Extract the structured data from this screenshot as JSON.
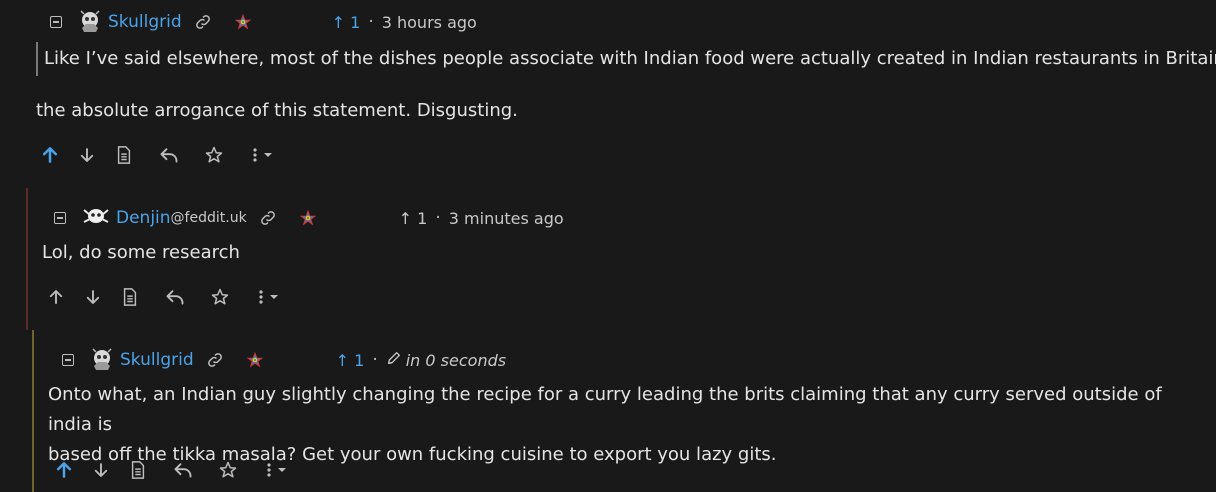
{
  "comments": [
    {
      "author": "Skullgrid",
      "instance": "",
      "score": "1",
      "time": "3 hours ago",
      "quote": "Like I’ve said elsewhere, most of the dishes people associate with Indian food were actually created in Indian restaurants in Britain.",
      "body": "the absolute arrogance of this statement. Disgusting.",
      "upvoted": true
    },
    {
      "author": "Denjin",
      "instance": "@feddit.uk",
      "score": "1",
      "time": "3 minutes ago",
      "body": "Lol, do some research",
      "upvoted": false
    },
    {
      "author": "Skullgrid",
      "instance": "",
      "score": "1",
      "time": "in 0 seconds",
      "body_line1": "Onto what, an Indian guy slightly changing the recipe for a curry leading the brits claiming that any curry served outside of india is",
      "body_line2": "based off the tikka masala? Get your own fucking cuisine to export you lazy gits.",
      "upvoted": true
    }
  ],
  "glyphs": {
    "score_arrow": "↑",
    "separator": "·",
    "more": "⋮"
  },
  "colors": {
    "background": "#191919",
    "username": "#4aa3e8",
    "upvote_active": "#4aa3e8",
    "thread_line_1": "#5a2b2b",
    "thread_line_2": "#6b6330"
  },
  "icons": [
    "collapse-icon",
    "avatar",
    "link-icon",
    "rainbow-star-badge-icon",
    "upvote-icon",
    "downvote-icon",
    "view-source-icon",
    "reply-icon",
    "star-icon",
    "more-icon",
    "chevron-down-icon",
    "pencil-icon"
  ]
}
